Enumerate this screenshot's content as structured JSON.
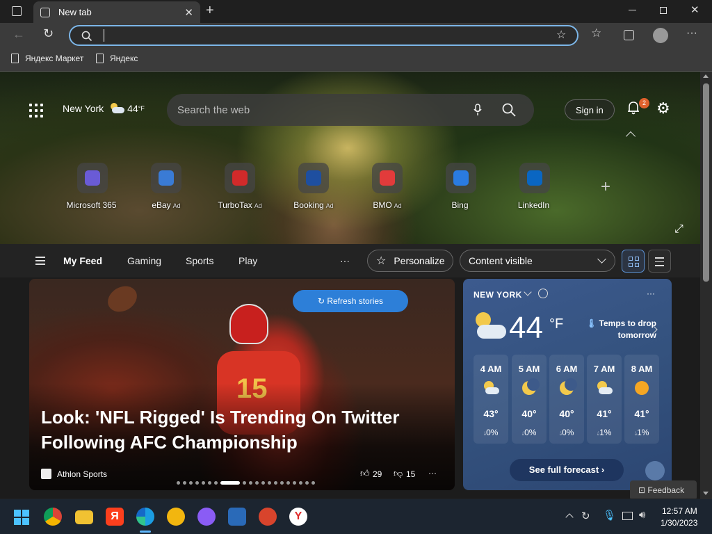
{
  "browser": {
    "tab_title": "New tab",
    "address_value": "",
    "favorites": [
      "Яндекс Маркет",
      "Яндекс"
    ]
  },
  "header": {
    "location": "New York",
    "temp": "44",
    "temp_unit": "°F",
    "search_placeholder": "Search the web",
    "sign_in": "Sign in",
    "notification_count": "2"
  },
  "quick_links": [
    {
      "label": "Microsoft 365",
      "ad": "",
      "color": "#6a5bd6"
    },
    {
      "label": "eBay",
      "ad": "Ad",
      "color": "#3a7bd5"
    },
    {
      "label": "TurboTax",
      "ad": "Ad",
      "color": "#d12a2a"
    },
    {
      "label": "Booking",
      "ad": "Ad",
      "color": "#1e4fa0"
    },
    {
      "label": "BMO",
      "ad": "Ad",
      "color": "#e23b3b"
    },
    {
      "label": "Bing",
      "ad": "",
      "color": "#2a7be0"
    },
    {
      "label": "LinkedIn",
      "ad": "",
      "color": "#0a66c2"
    }
  ],
  "feed_nav": {
    "items": [
      "My Feed",
      "Gaming",
      "Sports",
      "Play"
    ],
    "more": "···",
    "personalize": "Personalize",
    "content_visible": "Content visible"
  },
  "story": {
    "refresh": "Refresh stories",
    "headline": "Look: 'NFL Rigged' Is Trending On Twitter Following AFC Championship",
    "source": "Athlon Sports",
    "likes": "29",
    "dislikes": "15",
    "more": "···",
    "jersey_number": "15"
  },
  "weather": {
    "city": "NEW YORK",
    "temp": "44",
    "unit": "°F",
    "alert": "Temps to drop tomorrow",
    "more": "···",
    "hours": [
      {
        "time": "4 AM",
        "temp": "43°",
        "precip": "0%",
        "icon": "partly-cloudy-night-icon"
      },
      {
        "time": "5 AM",
        "temp": "40°",
        "precip": "0%",
        "icon": "moon-icon"
      },
      {
        "time": "6 AM",
        "temp": "40°",
        "precip": "0%",
        "icon": "moon-icon"
      },
      {
        "time": "7 AM",
        "temp": "41°",
        "precip": "1%",
        "icon": "partly-cloudy-night-icon"
      },
      {
        "time": "8 AM",
        "temp": "41°",
        "precip": "1%",
        "icon": "sun-icon"
      }
    ],
    "forecast_btn": "See full forecast",
    "feedback": "Feedback"
  },
  "taskbar": {
    "time": "12:57 AM",
    "date": "1/30/2023"
  }
}
